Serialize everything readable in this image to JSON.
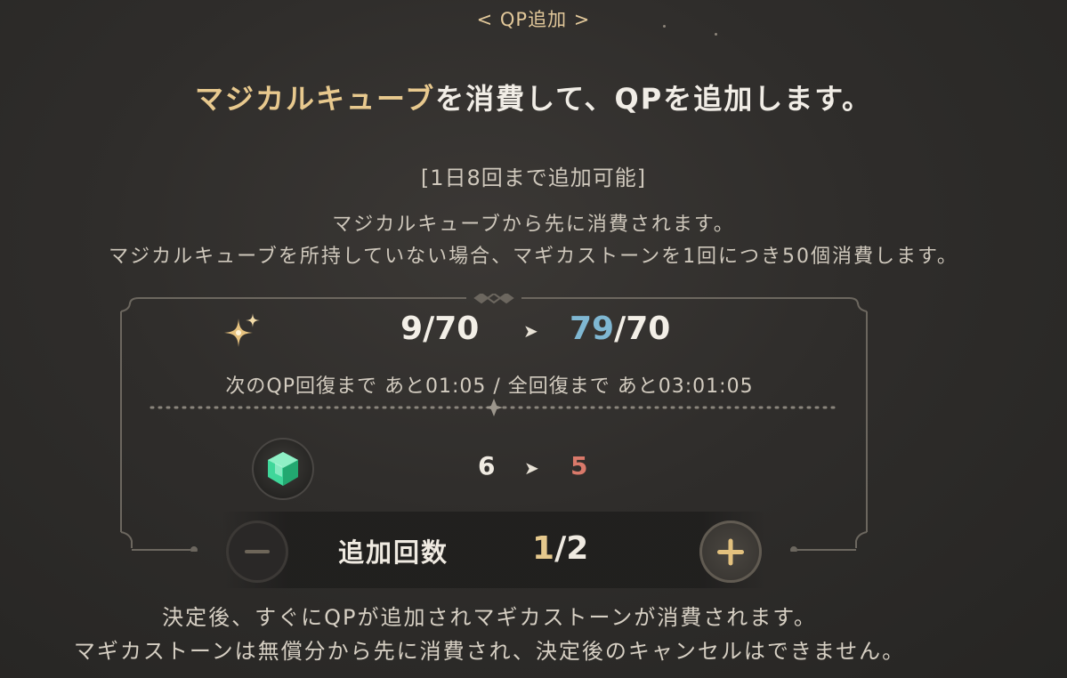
{
  "header": {
    "title": "< QP追加 >"
  },
  "message": {
    "highlight": "マジカルキューブ",
    "rest": "を消費して、QPを追加します。"
  },
  "limit_note": "[1日8回まで追加可能]",
  "description": {
    "line1": "マジカルキューブから先に消費されます。",
    "line2": "マジカルキューブを所持していない場合、マギカストーンを1回につき50個消費します。"
  },
  "qp": {
    "icon": "sparkle-icon",
    "before_current": "9",
    "before_max": "/70",
    "arrow": "➤",
    "after_current": "79",
    "after_max": "/70",
    "after_color": "#7fb7d2"
  },
  "recovery": {
    "text": "次のQP回復まで あと01:05 / 全回復まで あと03:01:05"
  },
  "cube": {
    "icon": "magical-cube-icon",
    "before": "6",
    "arrow": "➤",
    "after": "5",
    "after_color": "#d9796a"
  },
  "stepper": {
    "label": "追加回数",
    "current": "1",
    "max": "/2",
    "minus_icon": "minus-icon",
    "plus_icon": "plus-icon",
    "current_color": "#e6c98d"
  },
  "footer": {
    "line1": "決定後、すぐにQPが追加されマギカストーンが消費されます。",
    "line2": "マギカストーンは無償分から先に消費され、決定後のキャンセルはできません。"
  }
}
